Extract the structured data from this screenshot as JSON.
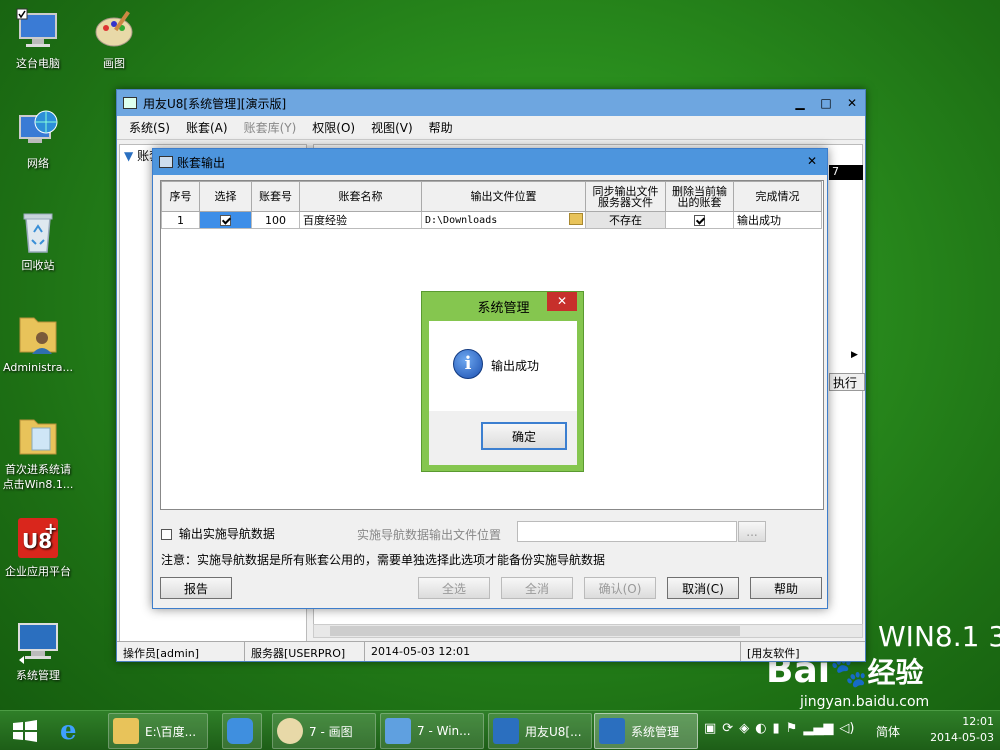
{
  "desktop": {
    "icons": [
      {
        "label": "这台电脑"
      },
      {
        "label": "画图"
      },
      {
        "label": "网络"
      },
      {
        "label": "回收站"
      },
      {
        "label": "Administra..."
      },
      {
        "label": "首次进系统请点击Win8.1..."
      },
      {
        "label": "企业应用平台"
      },
      {
        "label": "系统管理"
      }
    ],
    "watermark": {
      "os_text": "WIN8.1 3",
      "baidu": "Bai",
      "baidu_cn": "经验",
      "url": "jingyan.baidu.com"
    }
  },
  "main_window": {
    "title": "用友U8[系统管理][演示版]",
    "menu": [
      "系统(S)",
      "账套(A)",
      "账套库(Y)",
      "权限(O)",
      "视图(V)",
      "帮助"
    ],
    "tree_item": "账套",
    "right_cell": "7",
    "exec_label": "执行功",
    "status": {
      "operator": "操作员[admin]",
      "server": "服务器[USERPRO]",
      "datetime": "2014-05-03 12:01",
      "vendor": "[用友软件]"
    }
  },
  "export_dialog": {
    "title": "账套输出",
    "columns": [
      "序号",
      "选择",
      "账套号",
      "账套名称",
      "输出文件位置",
      "同步输出文件服务器文件",
      "删除当前输出的账套",
      "完成情况"
    ],
    "rows": [
      {
        "index": "1",
        "selected": true,
        "code": "100",
        "name": "百度经验",
        "path": "D:\\Downloads",
        "sync": "不存在",
        "delete": true,
        "status": "输出成功"
      }
    ],
    "nav_checkbox_label": "输出实施导航数据",
    "nav_path_label": "实施导航数据输出文件位置",
    "nav_path_value": "",
    "browse_label": "...",
    "note": "注意：实施导航数据是所有账套公用的，需要单独选择此选项才能备份实施导航数据",
    "buttons": {
      "report": "报告",
      "select_all": "全选",
      "deselect_all": "全消",
      "confirm": "确认(O)",
      "cancel": "取消(C)",
      "help": "帮助"
    }
  },
  "message_box": {
    "title": "系统管理",
    "text": "输出成功",
    "ok": "确定"
  },
  "taskbar": {
    "items": [
      {
        "label": "E:\\百度..."
      },
      {
        "label": ""
      },
      {
        "label": "7 - 画图"
      },
      {
        "label": "7 - Win..."
      },
      {
        "label": "用友U8[..."
      },
      {
        "label": "系统管理"
      }
    ],
    "ime": "简体",
    "time": "12:01",
    "date": "2014-05-03"
  }
}
